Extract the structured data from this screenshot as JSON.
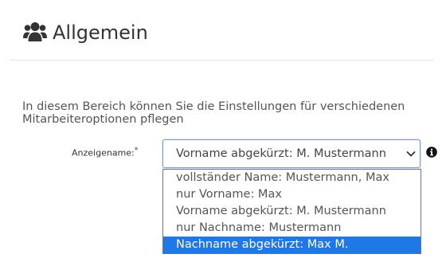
{
  "header": {
    "icon": "users-icon",
    "title": "Allgemein"
  },
  "description": "In diesem Bereich können Sie die Einstellungen für verschiedenen Mitarbeiteroptionen pflegen",
  "field": {
    "label": "Anzeigename:",
    "required_marker": "*",
    "selected_value": "Vorname abgekürzt: M. Mustermann",
    "chevron_icon": "chevron-down-icon",
    "info_icon": "info-icon",
    "options": [
      {
        "label": "vollständer Name: Mustermann, Max"
      },
      {
        "label": "nur Vorname: Max"
      },
      {
        "label": "Vorname abgekürzt: M. Mustermann"
      },
      {
        "label": "nur Nachname: Mustermann"
      },
      {
        "label": "Nachname abgekürzt: Max M."
      }
    ],
    "highlighted_option_index": 4
  },
  "colors": {
    "highlight": "#1e78e6",
    "focus_border": "#7a9cd3",
    "text": "#333333"
  }
}
